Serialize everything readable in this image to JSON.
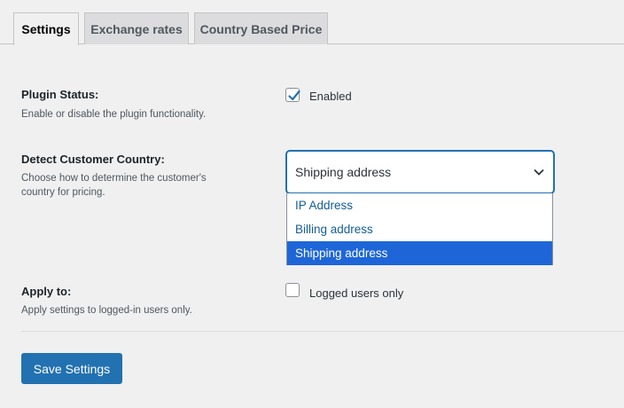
{
  "tabs": [
    {
      "label": "Settings",
      "active": true
    },
    {
      "label": "Exchange rates",
      "active": false
    },
    {
      "label": "Country Based Price",
      "active": false
    }
  ],
  "plugin_status": {
    "label": "Plugin Status:",
    "description": "Enable or disable the plugin functionality.",
    "checkbox_label": "Enabled",
    "checked": true
  },
  "detect_country": {
    "label": "Detect Customer Country:",
    "description_line1": "Choose how to determine the customer's",
    "description_line2": "country for pricing.",
    "selected_value": "Shipping address",
    "options": [
      "IP Address",
      "Billing address",
      "Shipping address"
    ]
  },
  "apply_to": {
    "label": "Apply to:",
    "description": "Apply settings to logged-in users only.",
    "checkbox_label": "Logged users only",
    "checked": false
  },
  "save_button": "Save Settings",
  "colors": {
    "accent": "#2271b1",
    "option_highlight": "#1e66d8",
    "background": "#f0f0f1"
  }
}
